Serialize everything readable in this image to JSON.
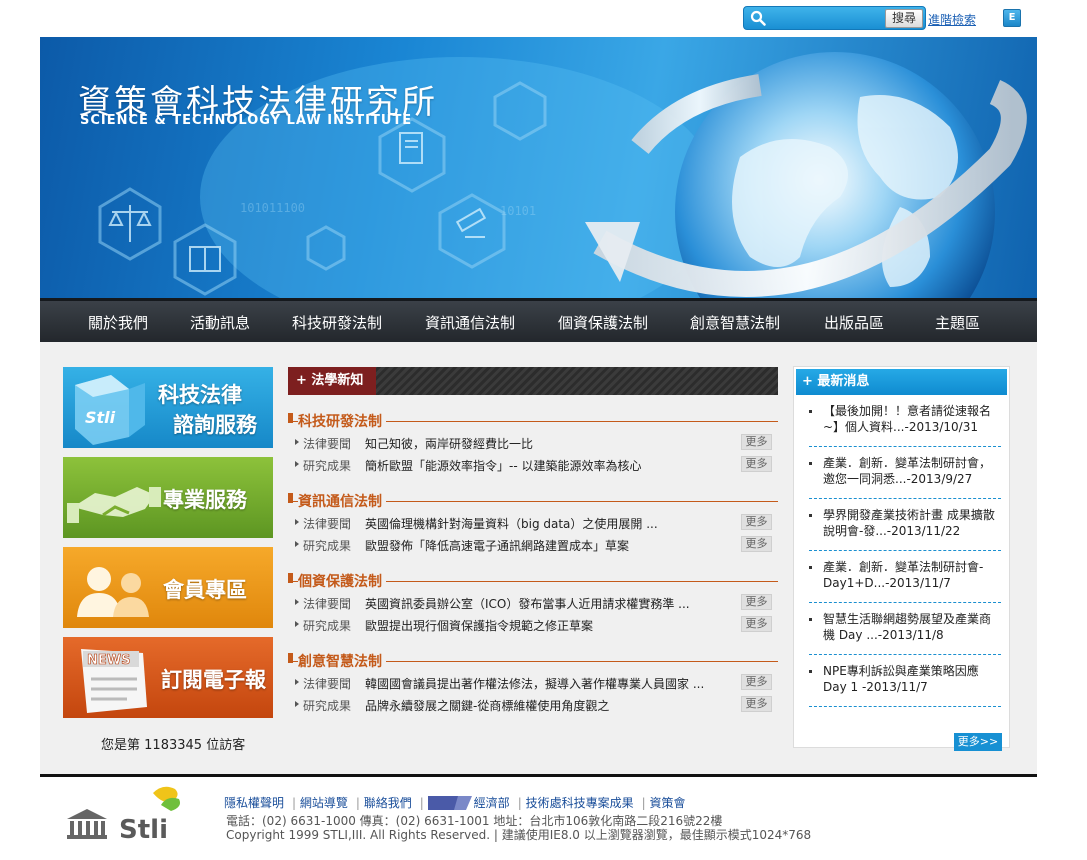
{
  "search": {
    "placeholder": "",
    "button": "搜尋",
    "advanced": "進階檢索",
    "lang_button": "E"
  },
  "banner": {
    "title": "資策會科技法律研究所",
    "subtitle": "SCIENCE & TECHNOLOGY  LAW INSTITUTE"
  },
  "nav": [
    "關於我們",
    "活動訊息",
    "科技研發法制",
    "資訊通信法制",
    "個資保護法制",
    "創意智慧法制",
    "出版品區",
    "主題區"
  ],
  "tiles": {
    "consult_line1": "科技法律",
    "consult_line2": "諮詢服務",
    "consult_logo": "Stli",
    "service": "專業服務",
    "member": "會員專區",
    "newsletter": "訂閱電子報",
    "newsletter_badge": "NEWS"
  },
  "visitor": {
    "prefix": "您是第",
    "count": "1183345",
    "suffix": "位訪客"
  },
  "law_news": {
    "header": "+ 法學新知",
    "more_label": "更多",
    "categories": [
      {
        "title": "科技研發法制",
        "items": [
          {
            "type": "法律要聞",
            "title": "知己知彼，兩岸研發經費比一比"
          },
          {
            "type": "研究成果",
            "title": "簡析歐盟「能源效率指令」-- 以建築能源效率為核心"
          }
        ]
      },
      {
        "title": "資訊通信法制",
        "items": [
          {
            "type": "法律要聞",
            "title": "英國倫理機構針對海量資料（big data）之使用展開 ..."
          },
          {
            "type": "研究成果",
            "title": "歐盟發佈「降低高速電子通訊網路建置成本」草案"
          }
        ]
      },
      {
        "title": "個資保護法制",
        "items": [
          {
            "type": "法律要聞",
            "title": "英國資訊委員辦公室（ICO）發布當事人近用請求權實務準 ..."
          },
          {
            "type": "研究成果",
            "title": "歐盟提出現行個資保護指令規範之修正草案"
          }
        ]
      },
      {
        "title": "創意智慧法制",
        "items": [
          {
            "type": "法律要聞",
            "title": "韓國國會議員提出著作權法修法，擬導入著作權專業人員國家 ..."
          },
          {
            "type": "研究成果",
            "title": "品牌永續發展之關鍵-從商標維權使用角度觀之"
          }
        ]
      }
    ]
  },
  "latest": {
    "header": "+ 最新消息",
    "more": "更多>>",
    "items": [
      "【最後加開！！意者請從速報名~】個人資料...-2013/10/31",
      "產業．創新．變革法制研討會，邀您一同洞悉...-2013/9/27",
      "學界開發產業技術計畫 成果擴散說明會-發...-2013/11/22",
      "產業．創新．變革法制研討會-Day1+D...-2013/11/7",
      "智慧生活聯網趨勢展望及產業商機 Day ...-2013/11/8",
      "NPE專利訴訟與產業策略因應Day 1 -2013/11/7"
    ]
  },
  "footer": {
    "logo_text": "Stli",
    "links": [
      "隱私權聲明",
      "網站導覽",
      "聯絡我們",
      "經濟部",
      "技術處科技專案成果",
      "資策會"
    ],
    "line1": "電話：(02) 6631-1000  傳真：(02) 6631-1001  地址：台北市106敦化南路二段216號22樓",
    "line2": "Copyright 1999 STLI,III. All Rights Reserved. | 建議使用IE8.0 以上瀏覽器瀏覽，最佳顯示模式1024*768"
  }
}
